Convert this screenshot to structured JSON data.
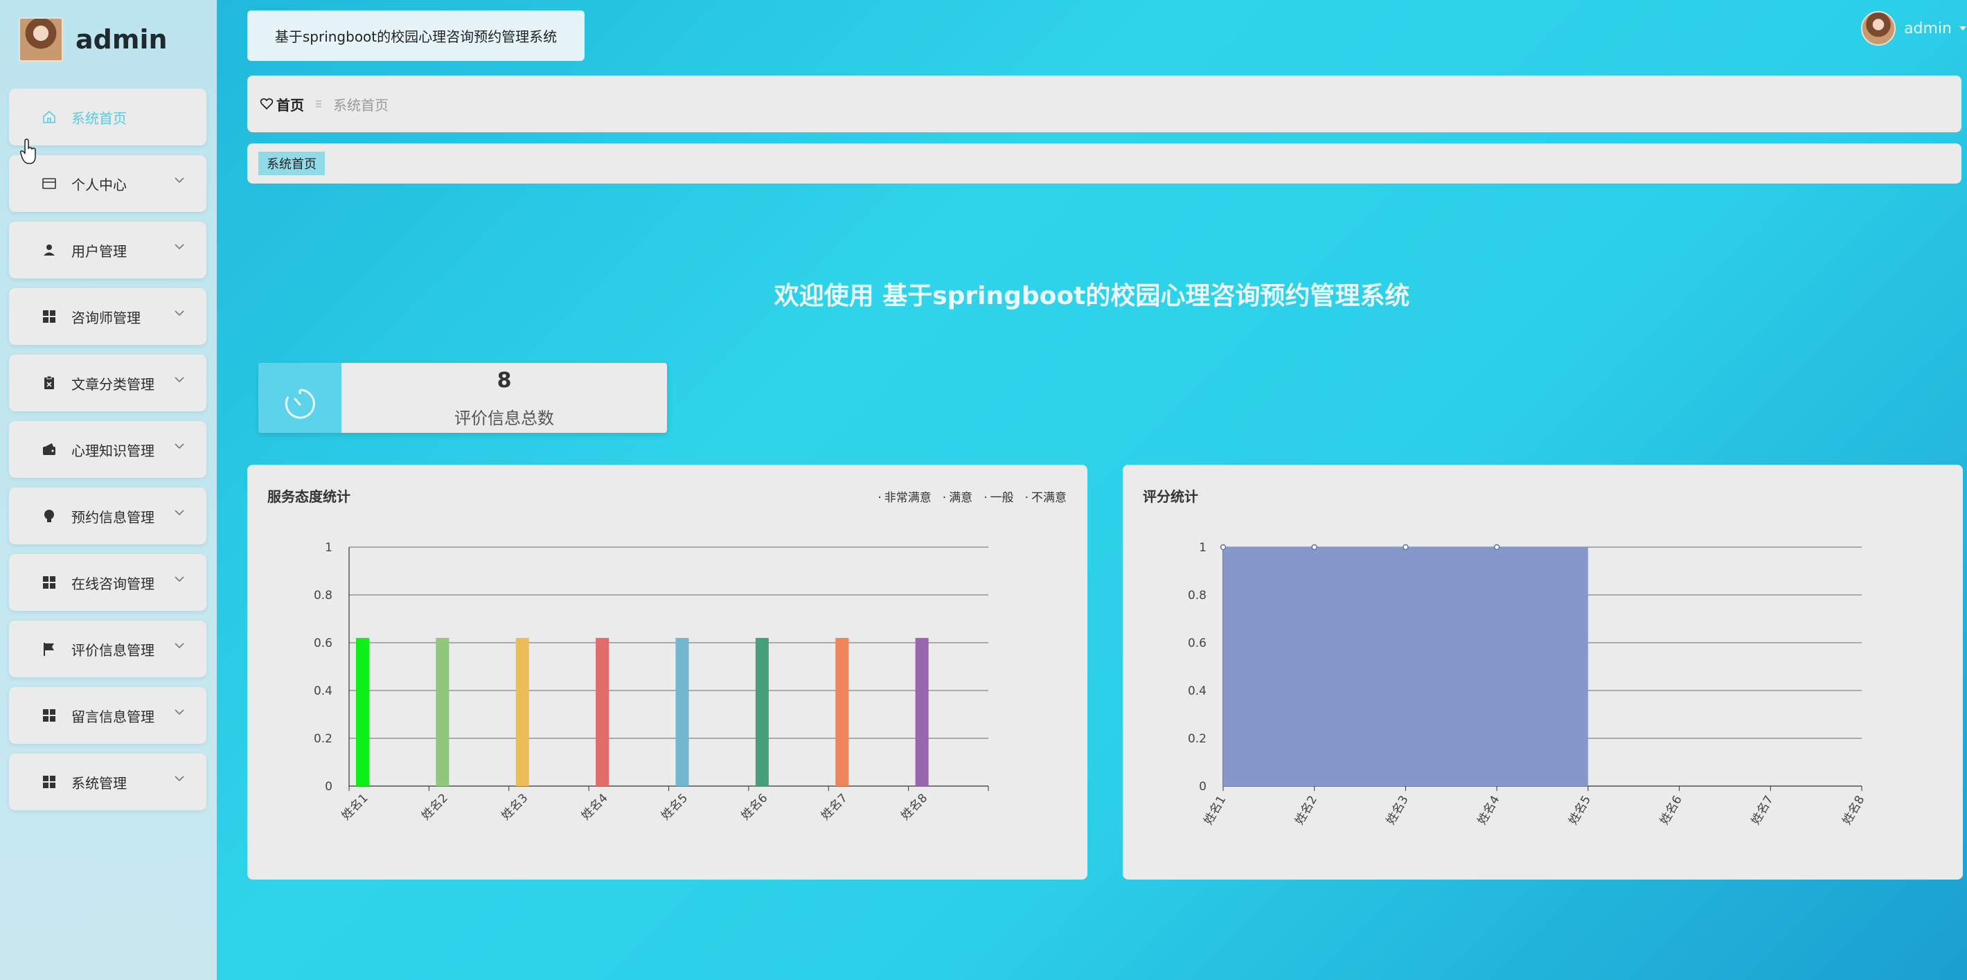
{
  "sidebar": {
    "brand": "admin",
    "items": [
      {
        "label": "系统首页",
        "icon": "home-icon",
        "active": true
      },
      {
        "label": "个人中心",
        "icon": "card-icon"
      },
      {
        "label": "用户管理",
        "icon": "user-icon"
      },
      {
        "label": "咨询师管理",
        "icon": "grid-icon"
      },
      {
        "label": "文章分类管理",
        "icon": "clipboard-icon"
      },
      {
        "label": "心理知识管理",
        "icon": "wallet-icon"
      },
      {
        "label": "预约信息管理",
        "icon": "bulb-icon"
      },
      {
        "label": "在线咨询管理",
        "icon": "grid-icon"
      },
      {
        "label": "评价信息管理",
        "icon": "flag-icon"
      },
      {
        "label": "留言信息管理",
        "icon": "grid-icon"
      },
      {
        "label": "系统管理",
        "icon": "grid-icon"
      }
    ]
  },
  "header": {
    "system_title": "基于springboot的校园心理咨询预约管理系统",
    "user_name": "admin"
  },
  "breadcrumb": {
    "home": "首页",
    "current": "系统首页"
  },
  "tags": {
    "active": "系统首页"
  },
  "welcome": "欢迎使用 基于springboot的校园心理咨询预约管理系统",
  "stat": {
    "value": "8",
    "label": "评价信息总数"
  },
  "colors": {
    "accent": "#5cd3ea",
    "area": "#8697c9"
  },
  "chart_data": [
    {
      "type": "bar",
      "title": "服务态度统计",
      "legend": [
        "非常满意",
        "满意",
        "一般",
        "不满意"
      ],
      "legend_position": "top-right",
      "categories": [
        "姓名1",
        "姓名2",
        "姓名3",
        "姓名4",
        "姓名5",
        "姓名6",
        "姓名7",
        "姓名8"
      ],
      "values": [
        0.62,
        0.62,
        0.62,
        0.62,
        0.62,
        0.62,
        0.62,
        0.62
      ],
      "bar_colors": [
        "#10ee19",
        "#91c77d",
        "#ecbd57",
        "#e06d6a",
        "#72b7cc",
        "#459f78",
        "#ee855a",
        "#9866ae"
      ],
      "ylim": [
        0,
        1
      ],
      "yticks": [
        "0",
        "0.2",
        "0.4",
        "0.6",
        "0.8",
        "1"
      ],
      "grid": true
    },
    {
      "type": "area",
      "title": "评分统计",
      "categories": [
        "姓名1",
        "姓名2",
        "姓名3",
        "姓名4",
        "姓名5",
        "姓名6",
        "姓名7",
        "姓名8"
      ],
      "values": [
        1,
        1,
        1,
        1,
        0,
        0,
        0,
        0
      ],
      "ylim": [
        0,
        1
      ],
      "yticks": [
        "0",
        "0.2",
        "0.4",
        "0.6",
        "0.8",
        "1"
      ],
      "grid": true
    }
  ]
}
